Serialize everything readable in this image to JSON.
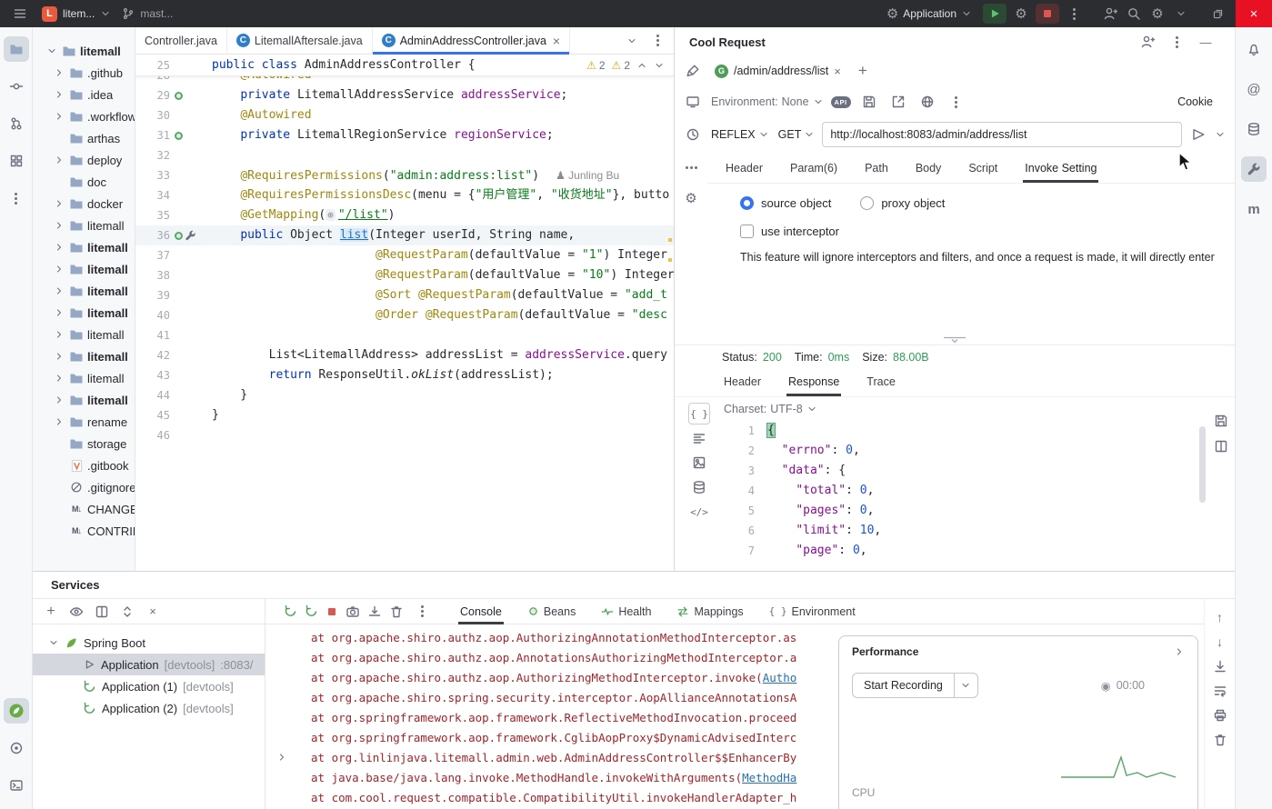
{
  "titlebar": {
    "project_name": "litem...",
    "branch_name": "mast...",
    "run_config_label": "Application"
  },
  "project_tree": {
    "root": "litemall",
    "items": [
      {
        "label": ".github",
        "icon": "folder",
        "chev": true,
        "bold": false
      },
      {
        "label": ".idea",
        "icon": "folder",
        "chev": true,
        "bold": false
      },
      {
        "label": ".workflow",
        "icon": "folder",
        "chev": true,
        "bold": false
      },
      {
        "label": "arthas",
        "icon": "folder",
        "chev": false,
        "bold": false
      },
      {
        "label": "deploy",
        "icon": "folder",
        "chev": true,
        "bold": false
      },
      {
        "label": "doc",
        "icon": "folder",
        "chev": false,
        "bold": false
      },
      {
        "label": "docker",
        "icon": "folder",
        "chev": true,
        "bold": false
      },
      {
        "label": "litemall",
        "icon": "folder",
        "chev": true,
        "bold": false
      },
      {
        "label": "litemall",
        "icon": "folder",
        "chev": true,
        "bold": true
      },
      {
        "label": "litemall",
        "icon": "folder",
        "chev": true,
        "bold": true
      },
      {
        "label": "litemall",
        "icon": "folder",
        "chev": true,
        "bold": true
      },
      {
        "label": "litemall",
        "icon": "folder",
        "chev": true,
        "bold": true
      },
      {
        "label": "litemall",
        "icon": "folder",
        "chev": true,
        "bold": false
      },
      {
        "label": "litemall",
        "icon": "folder",
        "chev": true,
        "bold": true
      },
      {
        "label": "litemall",
        "icon": "folder",
        "chev": true,
        "bold": false
      },
      {
        "label": "litemall",
        "icon": "folder",
        "chev": true,
        "bold": true
      },
      {
        "label": "rename",
        "icon": "folder",
        "chev": true,
        "bold": false
      },
      {
        "label": "storage",
        "icon": "folder",
        "chev": false,
        "bold": false
      },
      {
        "label": ".gitbook",
        "icon": "filev",
        "chev": false,
        "bold": false
      },
      {
        "label": ".gitignore",
        "icon": "ignored",
        "chev": false,
        "bold": false
      },
      {
        "label": "CHANGELOG.md",
        "icon": "markdown",
        "chev": false,
        "bold": false
      },
      {
        "label": "CONTRIBUTING.md",
        "icon": "markdown",
        "chev": false,
        "bold": false
      }
    ]
  },
  "editor": {
    "tabs": [
      {
        "label": "Controller.java",
        "icon": false,
        "selected": false,
        "closable": false
      },
      {
        "label": "LitemallAftersale.java",
        "icon": true,
        "selected": false,
        "closable": false
      },
      {
        "label": "AdminAddressController.java",
        "icon": true,
        "selected": true,
        "closable": true
      }
    ],
    "sticky": {
      "n": "25",
      "tokens": [
        [
          "public class ",
          "kw"
        ],
        [
          "AdminAddressController ",
          ""
        ],
        [
          "{",
          ""
        ]
      ],
      "warnings": [
        "2",
        "2"
      ]
    },
    "lines": [
      {
        "n": "28",
        "g": [],
        "t": [
          [
            "    @Autowired",
            "ann"
          ]
        ]
      },
      {
        "n": "29",
        "g": [
          "bean"
        ],
        "t": [
          [
            "    ",
            ""
          ],
          [
            "private ",
            "kw"
          ],
          [
            "LitemallAddressService ",
            ""
          ],
          [
            "addressService",
            "fld"
          ],
          [
            ";",
            ""
          ]
        ]
      },
      {
        "n": "30",
        "g": [],
        "t": [
          [
            "    ",
            ""
          ],
          [
            "@Autowired",
            "ann"
          ]
        ]
      },
      {
        "n": "31",
        "g": [
          "bean"
        ],
        "t": [
          [
            "    ",
            ""
          ],
          [
            "private ",
            "kw"
          ],
          [
            "LitemallRegionService ",
            ""
          ],
          [
            "regionService",
            "fld"
          ],
          [
            ";",
            ""
          ]
        ]
      },
      {
        "n": "32",
        "g": [],
        "t": []
      },
      {
        "n": "33",
        "g": [],
        "t": [
          [
            "    ",
            ""
          ],
          [
            "@RequiresPermissions",
            "ann"
          ],
          [
            "(",
            ""
          ],
          [
            "\"admin:address:list\"",
            "str"
          ],
          [
            ")",
            ""
          ]
        ],
        "author": "Junling Bu"
      },
      {
        "n": "34",
        "g": [],
        "t": [
          [
            "    ",
            ""
          ],
          [
            "@RequiresPermissionsDesc",
            "ann"
          ],
          [
            "(menu = {",
            ""
          ],
          [
            "\"用户管理\"",
            "str"
          ],
          [
            ", ",
            ""
          ],
          [
            "\"收货地址\"",
            "str"
          ],
          [
            "}, butto",
            ""
          ]
        ]
      },
      {
        "n": "35",
        "g": [],
        "t": [
          [
            "    ",
            ""
          ],
          [
            "@GetMapping",
            "ann"
          ],
          [
            "(",
            ""
          ],
          [
            "⊕",
            "inlay"
          ],
          [
            "\"/list\"",
            "strlnk"
          ],
          [
            ")",
            ""
          ]
        ]
      },
      {
        "n": "36",
        "g": [
          "bean",
          "api"
        ],
        "caret": true,
        "t": [
          [
            "    ",
            ""
          ],
          [
            "public ",
            "kw"
          ],
          [
            "Object ",
            ""
          ],
          [
            "list",
            "mth"
          ],
          [
            "(Integer userId, String name,",
            ""
          ]
        ]
      },
      {
        "n": "37",
        "g": [],
        "t": [
          [
            "                       ",
            ""
          ],
          [
            "@RequestParam",
            "ann"
          ],
          [
            "(defaultValue = ",
            ""
          ],
          [
            "\"1\"",
            "str"
          ],
          [
            ") Integer",
            ""
          ]
        ]
      },
      {
        "n": "38",
        "g": [],
        "t": [
          [
            "                       ",
            ""
          ],
          [
            "@RequestParam",
            "ann"
          ],
          [
            "(defaultValue = ",
            ""
          ],
          [
            "\"10\"",
            "str"
          ],
          [
            ") Integer",
            ""
          ]
        ]
      },
      {
        "n": "39",
        "g": [],
        "t": [
          [
            "                       ",
            ""
          ],
          [
            "@Sort ",
            "ann"
          ],
          [
            "@RequestParam",
            "ann"
          ],
          [
            "(defaultValue = ",
            ""
          ],
          [
            "\"add_t",
            "str"
          ]
        ]
      },
      {
        "n": "40",
        "g": [],
        "t": [
          [
            "                       ",
            ""
          ],
          [
            "@Order ",
            "ann"
          ],
          [
            "@RequestParam",
            "ann"
          ],
          [
            "(defaultValue = ",
            ""
          ],
          [
            "\"desc",
            "str"
          ]
        ]
      },
      {
        "n": "41",
        "g": [],
        "t": []
      },
      {
        "n": "42",
        "g": [],
        "t": [
          [
            "        ",
            ""
          ],
          [
            "List<LitemallAddress> addressList = ",
            ""
          ],
          [
            "addressService",
            "fld"
          ],
          [
            ".query",
            ""
          ]
        ]
      },
      {
        "n": "43",
        "g": [],
        "t": [
          [
            "        ",
            ""
          ],
          [
            "return ",
            "kw"
          ],
          [
            "ResponseUtil.",
            ""
          ],
          [
            "okList",
            "ital"
          ],
          [
            "(addressList);",
            ""
          ]
        ]
      },
      {
        "n": "44",
        "g": [],
        "t": [
          [
            "    }",
            ""
          ]
        ]
      },
      {
        "n": "45",
        "g": [],
        "t": [
          [
            "}",
            ""
          ]
        ]
      },
      {
        "n": "46",
        "g": [],
        "t": []
      }
    ]
  },
  "cool_request": {
    "title": "Cool Request",
    "request_tab": {
      "method_badge": "G",
      "path": "/admin/address/list"
    },
    "environment_label": "Environment:",
    "environment_value": "None",
    "cookie_label": "Cookie",
    "invoke_mode": "REFLEX",
    "http_method": "GET",
    "url": "http://localhost:8083/admin/address/list",
    "tabs": [
      "Header",
      "Param(6)",
      "Path",
      "Body",
      "Script",
      "Invoke Setting"
    ],
    "selected_tab": "Invoke Setting",
    "source_object_label": "source object",
    "proxy_object_label": "proxy object",
    "use_interceptor_label": "use interceptor",
    "note": "This feature will ignore interceptors and filters, and once a request is made, it will directly enter",
    "status_label": "Status:",
    "status_value": "200",
    "time_label": "Time:",
    "time_value": "0ms",
    "size_label": "Size:",
    "size_value": "88.00B",
    "result_tabs": [
      "Header",
      "Response",
      "Trace"
    ],
    "selected_result_tab": "Response",
    "charset_label": "Charset:",
    "charset_value": "UTF-8",
    "response_lines": [
      {
        "n": "1",
        "t": [
          [
            "{",
            "hl"
          ]
        ]
      },
      {
        "n": "2",
        "t": [
          [
            "  ",
            ""
          ],
          [
            "\"errno\"",
            "key"
          ],
          [
            ": ",
            ""
          ],
          [
            "0",
            "num"
          ],
          [
            ",",
            ""
          ]
        ]
      },
      {
        "n": "3",
        "t": [
          [
            "  ",
            ""
          ],
          [
            "\"data\"",
            "key"
          ],
          [
            ": {",
            ""
          ]
        ]
      },
      {
        "n": "4",
        "t": [
          [
            "    ",
            ""
          ],
          [
            "\"total\"",
            "key"
          ],
          [
            ": ",
            ""
          ],
          [
            "0",
            "num"
          ],
          [
            ",",
            ""
          ]
        ]
      },
      {
        "n": "5",
        "t": [
          [
            "    ",
            ""
          ],
          [
            "\"pages\"",
            "key"
          ],
          [
            ": ",
            ""
          ],
          [
            "0",
            "num"
          ],
          [
            ",",
            ""
          ]
        ]
      },
      {
        "n": "6",
        "t": [
          [
            "    ",
            ""
          ],
          [
            "\"limit\"",
            "key"
          ],
          [
            ": ",
            ""
          ],
          [
            "10",
            "num"
          ],
          [
            ",",
            ""
          ]
        ]
      },
      {
        "n": "7",
        "t": [
          [
            "    ",
            ""
          ],
          [
            "\"page\"",
            "key"
          ],
          [
            ": ",
            ""
          ],
          [
            "0",
            "num"
          ],
          [
            ",",
            ""
          ]
        ]
      }
    ]
  },
  "services": {
    "title": "Services",
    "tree": [
      {
        "label": "Spring Boot",
        "suffix": "",
        "extra": "",
        "icon": "leaf",
        "level": 0,
        "chev": true,
        "selected": false
      },
      {
        "label": "Application",
        "suffix": " [devtools]",
        "extra": " :8083/",
        "icon": "runoutline",
        "level": 1,
        "chev": false,
        "selected": true
      },
      {
        "label": "Application (1)",
        "suffix": " [devtools]",
        "extra": "",
        "icon": "restart",
        "level": 1,
        "chev": false,
        "selected": false
      },
      {
        "label": "Application (2)",
        "suffix": " [devtools]",
        "extra": "",
        "icon": "restart",
        "level": 1,
        "chev": false,
        "selected": false
      }
    ],
    "console_tabs": [
      {
        "label": "Console",
        "icon": "",
        "selected": true
      },
      {
        "label": "Beans",
        "icon": "beans",
        "selected": false
      },
      {
        "label": "Health",
        "icon": "health",
        "selected": false
      },
      {
        "label": "Mappings",
        "icon": "mappings",
        "selected": false
      },
      {
        "label": "Environment",
        "icon": "braces",
        "selected": false
      }
    ],
    "console_lines": [
      {
        "fold": false,
        "segs": [
          [
            "at org.apache.shiro.authz.aop.AuthorizingAnnotationMethodInterceptor.as",
            "err"
          ]
        ]
      },
      {
        "fold": false,
        "segs": [
          [
            "at org.apache.shiro.authz.aop.AnnotationsAuthorizingMethodInterceptor.a",
            "err"
          ]
        ]
      },
      {
        "fold": false,
        "segs": [
          [
            "at org.apache.shiro.authz.aop.AuthorizingMethodInterceptor.invoke(",
            "err"
          ],
          [
            "Autho",
            "lnk"
          ]
        ]
      },
      {
        "fold": false,
        "segs": [
          [
            "at org.apache.shiro.spring.security.interceptor.AopAllianceAnnotationsA",
            "err"
          ]
        ]
      },
      {
        "fold": false,
        "segs": [
          [
            "at org.springframework.aop.framework.ReflectiveMethodInvocation.proceed",
            "err"
          ]
        ]
      },
      {
        "fold": false,
        "segs": [
          [
            "at org.springframework.aop.framework.CglibAopProxy$DynamicAdvisedInterc",
            "err"
          ]
        ]
      },
      {
        "fold": true,
        "segs": [
          [
            "at org.linlinjava.litemall.admin.web.AdminAddressController$$EnhancerBy",
            "err"
          ]
        ]
      },
      {
        "fold": false,
        "segs": [
          [
            "at java.base/java.lang.invoke.MethodHandle.invokeWithArguments(",
            "err"
          ],
          [
            "MethodHa",
            "lnk"
          ]
        ]
      },
      {
        "fold": false,
        "segs": [
          [
            "at com.cool.request.compatible.CompatibilityUtil.invokeHandlerAdapter_h",
            "err"
          ]
        ]
      }
    ]
  },
  "performance": {
    "title": "Performance",
    "start_button_label": "Start Recording",
    "timer": "00:00",
    "cpu_label": "CPU"
  },
  "colors": {
    "accent_blue": "#3574f0",
    "run_green": "#2e9e57",
    "stop_red": "#d13c3c",
    "status_green": "#2e9e57",
    "console_error_red": "#a3242a",
    "annotation": "#9e880d",
    "keyword": "#0033b3",
    "string": "#067d17",
    "number": "#1750eb",
    "field": "#871094"
  }
}
